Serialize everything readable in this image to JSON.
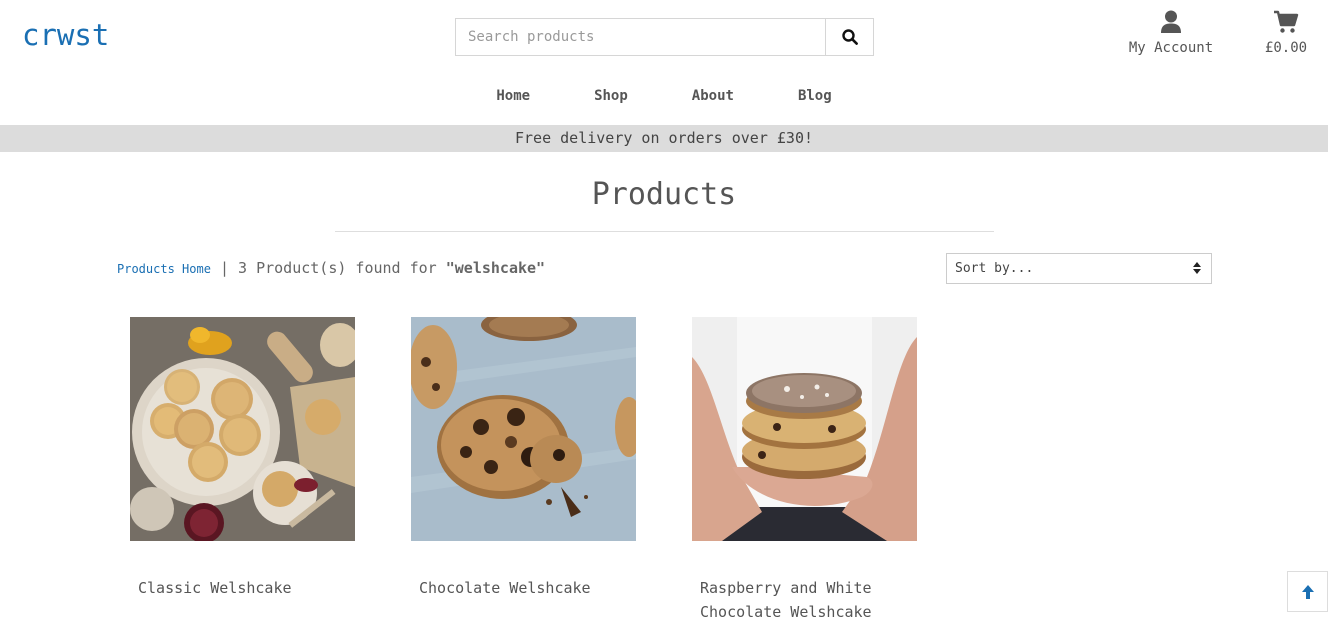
{
  "header": {
    "logo": "crwst",
    "search_placeholder": "Search products",
    "account_label": "My Account",
    "cart_total": "£0.00"
  },
  "nav": {
    "items": [
      {
        "label": "Home"
      },
      {
        "label": "Shop"
      },
      {
        "label": "About"
      },
      {
        "label": "Blog"
      }
    ]
  },
  "banner": {
    "text": "Free delivery on orders over £30!"
  },
  "main": {
    "title": "Products",
    "breadcrumb_link": "Products Home",
    "separator": "|",
    "results_text": "3 Product(s) found for",
    "search_term": "\"welshcake\"",
    "sort_label": "Sort by..."
  },
  "products": [
    {
      "name": "Classic Welshcake"
    },
    {
      "name": "Chocolate Welshcake"
    },
    {
      "name": "Raspberry and White Chocolate Welshcake"
    }
  ],
  "colors": {
    "brand": "#1a6fb3",
    "banner_bg": "#dcdcdc",
    "text": "#555555"
  },
  "icons": {
    "search": "search-icon",
    "account": "user-icon",
    "cart": "shopping-cart-icon",
    "sort": "sort-arrows-icon",
    "back_to_top": "arrow-up-icon"
  }
}
